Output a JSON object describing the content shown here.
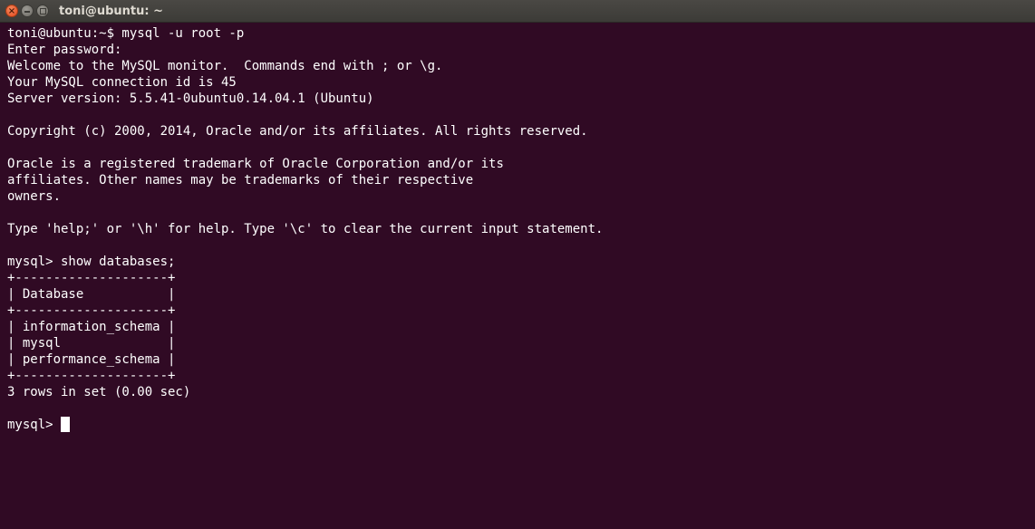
{
  "window": {
    "title": "toni@ubuntu: ~"
  },
  "terminal": {
    "lines": [
      "toni@ubuntu:~$ mysql -u root -p",
      "Enter password:",
      "Welcome to the MySQL monitor.  Commands end with ; or \\g.",
      "Your MySQL connection id is 45",
      "Server version: 5.5.41-0ubuntu0.14.04.1 (Ubuntu)",
      "",
      "Copyright (c) 2000, 2014, Oracle and/or its affiliates. All rights reserved.",
      "",
      "Oracle is a registered trademark of Oracle Corporation and/or its",
      "affiliates. Other names may be trademarks of their respective",
      "owners.",
      "",
      "Type 'help;' or '\\h' for help. Type '\\c' to clear the current input statement.",
      "",
      "mysql> show databases;",
      "+--------------------+",
      "| Database           |",
      "+--------------------+",
      "| information_schema |",
      "| mysql              |",
      "| performance_schema |",
      "+--------------------+",
      "3 rows in set (0.00 sec)",
      ""
    ],
    "prompt": "mysql> "
  },
  "colors": {
    "background": "#300a24",
    "text": "#ffffff",
    "titlebar": "#3c3b37",
    "close_button": "#e1461c"
  }
}
